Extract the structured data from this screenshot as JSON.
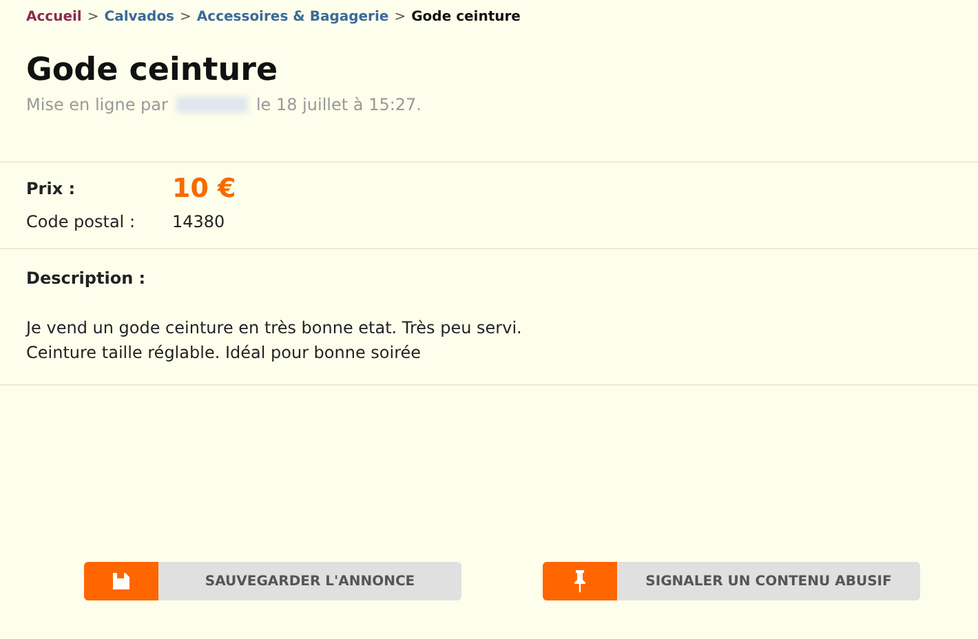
{
  "breadcrumb": [
    {
      "label": "Accueil",
      "kind": "home"
    },
    {
      "label": "Calvados",
      "kind": "link"
    },
    {
      "label": "Accessoires & Bagagerie",
      "kind": "link"
    },
    {
      "label": "Gode ceinture",
      "kind": "current"
    }
  ],
  "breadcrumb_separator": ">",
  "title": "Gode ceinture",
  "posted_prefix": "Mise en ligne par",
  "posted_date": "le 18 juillet à 15:27.",
  "price": {
    "label": "Prix :",
    "value": "10 €"
  },
  "postal_code": {
    "label": "Code postal :",
    "value": "14380"
  },
  "description": {
    "label": "Description :",
    "lines": [
      "Je vend un gode ceinture en très bonne etat. Très peu servi.",
      "Ceinture taille réglable. Idéal pour bonne soirée"
    ]
  },
  "buttons": [
    {
      "label": "SAUVEGARDER L'ANNONCE",
      "kind": "save"
    },
    {
      "label": "SIGNALER UN CONTENU ABUSIF",
      "kind": "report"
    }
  ]
}
